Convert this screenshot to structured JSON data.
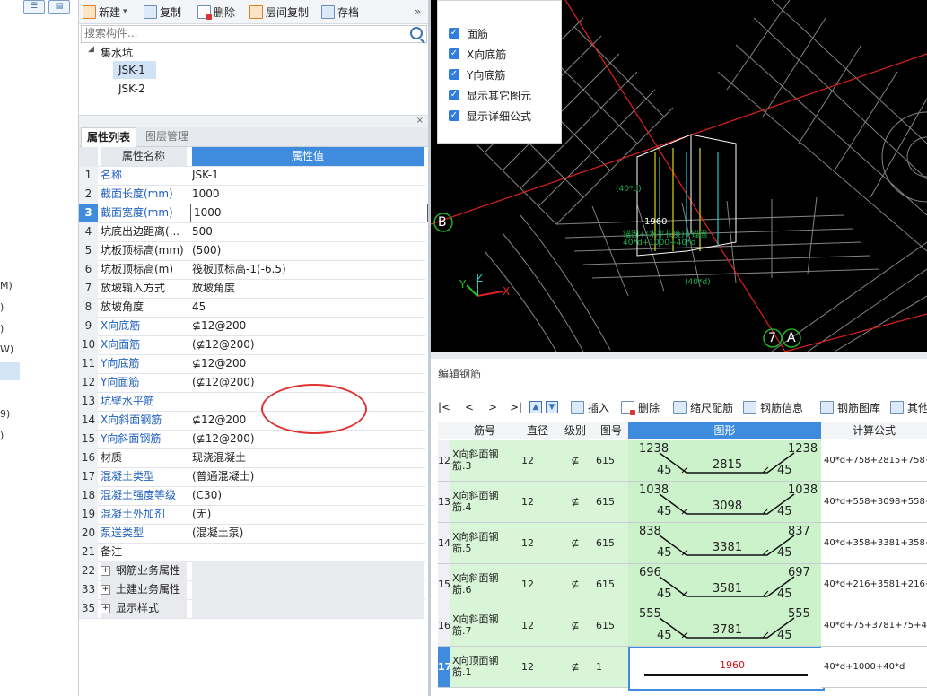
{
  "left_strip": {
    "glyphs": [
      "M)",
      ")",
      ")",
      "W)",
      "9)",
      ")"
    ]
  },
  "toolbar": {
    "new_label": "新建",
    "copy_label": "复制",
    "delete_label": "删除",
    "copy_layers_label": "层间复制",
    "archive_label": "存档",
    "more_label": "»"
  },
  "search": {
    "placeholder": "搜索构件..."
  },
  "tree": {
    "group_label": "集水坑",
    "items": [
      "JSK-1",
      "JSK-2"
    ],
    "selected": "JSK-1"
  },
  "tabs": [
    "属性列表",
    "图层管理"
  ],
  "props": {
    "header_name": "属性名称",
    "header_value": "属性值",
    "rows": [
      {
        "num": "1",
        "name": "名称",
        "value": "JSK-1"
      },
      {
        "num": "2",
        "name": "截面长度(mm)",
        "value": "1000"
      },
      {
        "num": "3",
        "name": "截面宽度(mm)",
        "value": "1000"
      },
      {
        "num": "4",
        "name": "坑底出边距离(...",
        "value": "500"
      },
      {
        "num": "5",
        "name": "坑板顶标高(mm)",
        "value": "(500)"
      },
      {
        "num": "6",
        "name": "坑板顶标高(m)",
        "value": "筏板顶标高-1(-6.5)"
      },
      {
        "num": "7",
        "name": "放坡输入方式",
        "value": "放坡角度"
      },
      {
        "num": "8",
        "name": "放坡角度",
        "value": "45"
      },
      {
        "num": "9",
        "name": "X向底筋",
        "value": "⊈12@200"
      },
      {
        "num": "10",
        "name": "X向面筋",
        "value": "(⊈12@200)"
      },
      {
        "num": "11",
        "name": "Y向底筋",
        "value": "⊈12@200"
      },
      {
        "num": "12",
        "name": "Y向面筋",
        "value": "(⊈12@200)"
      },
      {
        "num": "13",
        "name": "坑壁水平筋",
        "value": ""
      },
      {
        "num": "14",
        "name": "X向斜面钢筋",
        "value": "⊈12@200"
      },
      {
        "num": "15",
        "name": "Y向斜面钢筋",
        "value": "(⊈12@200)"
      },
      {
        "num": "16",
        "name": "材质",
        "value": "现浇混凝土"
      },
      {
        "num": "17",
        "name": "混凝土类型",
        "value": "(普通混凝土)"
      },
      {
        "num": "18",
        "name": "混凝土强度等级",
        "value": "(C30)"
      },
      {
        "num": "19",
        "name": "混凝土外加剂",
        "value": "(无)"
      },
      {
        "num": "20",
        "name": "泵送类型",
        "value": "(混凝土泵)"
      },
      {
        "num": "21",
        "name": "备注",
        "value": ""
      },
      {
        "num": "22",
        "name": "钢筋业务属性",
        "value": ""
      },
      {
        "num": "33",
        "name": "土建业务属性",
        "value": ""
      },
      {
        "num": "35",
        "name": "显示样式",
        "value": ""
      }
    ]
  },
  "viewport": {
    "checks": [
      "面筋",
      "X向底筋",
      "Y向底筋",
      "显示其它图元",
      "显示详细公式"
    ],
    "labels": {
      "b_axis": "B",
      "seven": "7",
      "a_axis": "A",
      "dim_1960": "1960",
      "anchor_1": "锚固+(水平长度)+锚固",
      "anchor_2": "40*d+1000+40*d",
      "d40_a": "(40*d)",
      "d40_b": "(40*d)",
      "axis_x": "X",
      "axis_y": "Y",
      "axis_z": "Z"
    }
  },
  "editor": {
    "title": "编辑钢筋",
    "toolbar": [
      "|<",
      "<",
      ">",
      ">|",
      "插入",
      "删除",
      "缩尺配筋",
      "钢筋信息",
      "钢筋图库",
      "其他"
    ],
    "columns": [
      "筋号",
      "直径(mm)",
      "级别",
      "图号",
      "图形",
      "计算公式"
    ],
    "rows": [
      {
        "idx": "12",
        "name": "X向斜面钢筋.3",
        "dia": "12",
        "grade": "⊈",
        "fig": "615",
        "l": "1238",
        "r": "1238",
        "mid": "2815",
        "bl": "45",
        "br": "45",
        "formula": "40*d+758+2815+758+4"
      },
      {
        "idx": "13",
        "name": "X向斜面钢筋.4",
        "dia": "12",
        "grade": "⊈",
        "fig": "615",
        "l": "1038",
        "r": "1038",
        "mid": "3098",
        "bl": "45",
        "br": "45",
        "formula": "40*d+558+3098+558+4"
      },
      {
        "idx": "14",
        "name": "X向斜面钢筋.5",
        "dia": "12",
        "grade": "⊈",
        "fig": "615",
        "l": "838",
        "r": "837",
        "mid": "3381",
        "bl": "45",
        "br": "45",
        "formula": "40*d+358+3381+358+4"
      },
      {
        "idx": "15",
        "name": "X向斜面钢筋.6",
        "dia": "12",
        "grade": "⊈",
        "fig": "615",
        "l": "696",
        "r": "697",
        "mid": "3581",
        "bl": "45",
        "br": "45",
        "formula": "40*d+216+3581+216+4"
      },
      {
        "idx": "16",
        "name": "X向斜面钢筋.7",
        "dia": "12",
        "grade": "⊈",
        "fig": "615",
        "l": "555",
        "r": "555",
        "mid": "3781",
        "bl": "45",
        "br": "45",
        "formula": "40*d+75+3781+75+40*"
      },
      {
        "idx": "17",
        "name": "X向顶面钢筋.1",
        "dia": "12",
        "grade": "⊈",
        "fig": "1",
        "l": "",
        "r": "",
        "mid": "1960",
        "bl": "",
        "br": "",
        "formula": "40*d+1000+40*d"
      }
    ]
  },
  "colors": {
    "accent": "#3f8cde",
    "row_green": "#d8f5d8",
    "annotation_red": "#e03232",
    "link_blue": "#1f5fbf"
  }
}
